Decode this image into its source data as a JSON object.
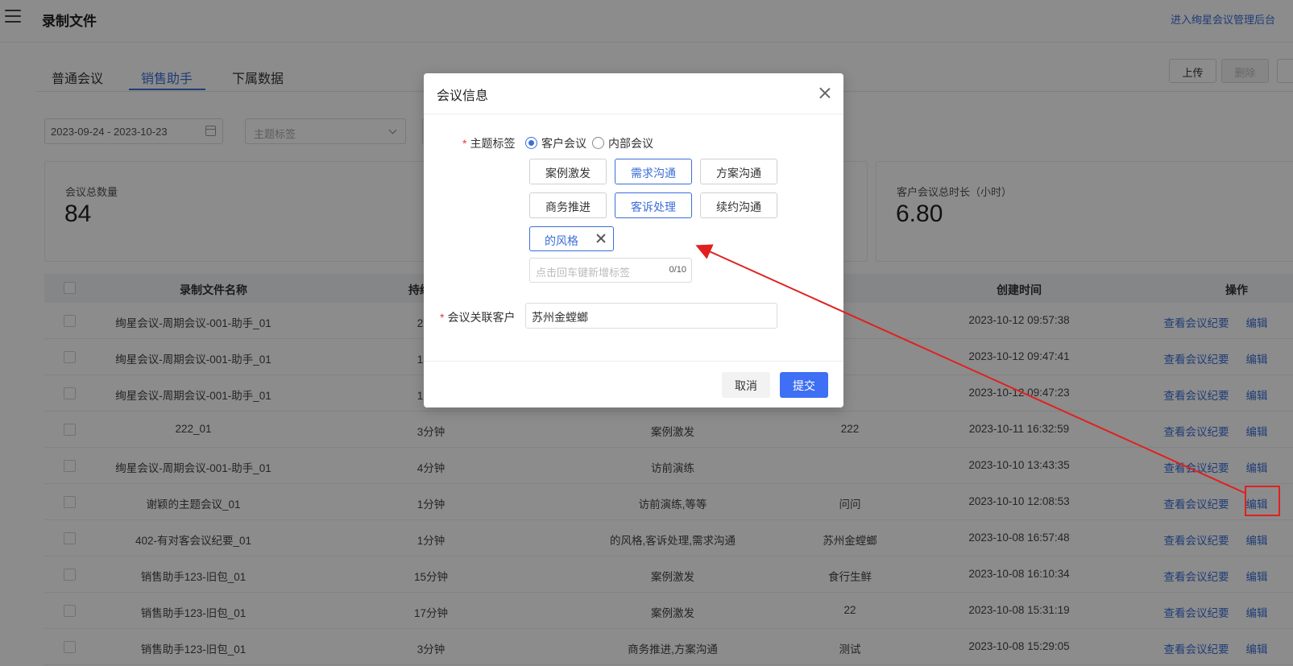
{
  "header": {
    "title": "录制文件",
    "admin_link": "进入绚星会议管理后台"
  },
  "tabs": [
    {
      "label": "普通会议"
    },
    {
      "label": "销售助手"
    },
    {
      "label": "下属数据"
    }
  ],
  "toolbar": {
    "upload_label": "上传",
    "delete_label": "删除"
  },
  "filters": {
    "date_range": "2023-09-24 - 2023-10-23",
    "topic_placeholder": "主题标签"
  },
  "stats": [
    {
      "label": "会议总数量",
      "value": "84"
    },
    {
      "label": "客户会议总时长（小时）",
      "value": "6.80"
    }
  ],
  "table": {
    "columns": [
      "录制文件名称",
      "持续时间",
      "",
      "",
      "创建时间",
      "操作"
    ],
    "rows": [
      {
        "name": "绚星会议-周期会议-001-助手_01",
        "duration": "2分钟",
        "tags": "",
        "customer": "",
        "created": "2023-10-12 09:57:38"
      },
      {
        "name": "绚星会议-周期会议-001-助手_01",
        "duration": "1分钟",
        "tags": "",
        "customer": "",
        "created": "2023-10-12 09:47:41"
      },
      {
        "name": "绚星会议-周期会议-001-助手_01",
        "duration": "1分钟",
        "tags": "",
        "customer": "",
        "created": "2023-10-12 09:47:23"
      },
      {
        "name": "222_01",
        "duration": "3分钟",
        "tags": "案例激发",
        "customer": "222",
        "created": "2023-10-11 16:32:59"
      },
      {
        "name": "绚星会议-周期会议-001-助手_01",
        "duration": "4分钟",
        "tags": "访前演练",
        "customer": "",
        "created": "2023-10-10 13:43:35"
      },
      {
        "name": "谢颖的主题会议_01",
        "duration": "1分钟",
        "tags": "访前演练,等等",
        "customer": "问问",
        "created": "2023-10-10 12:08:53"
      },
      {
        "name": "402-有对客会议纪要_01",
        "duration": "1分钟",
        "tags": "的风格,客诉处理,需求沟通",
        "customer": "苏州金螳螂",
        "created": "2023-10-08 16:57:48"
      },
      {
        "name": "销售助手123-旧包_01",
        "duration": "15分钟",
        "tags": "案例激发",
        "customer": "食行生鲜",
        "created": "2023-10-08 16:10:34"
      },
      {
        "name": "销售助手123-旧包_01",
        "duration": "17分钟",
        "tags": "案例激发",
        "customer": "22",
        "created": "2023-10-08 15:31:19"
      },
      {
        "name": "销售助手123-旧包_01",
        "duration": "3分钟",
        "tags": "商务推进,方案沟通",
        "customer": "测试",
        "created": "2023-10-08 15:29:05"
      }
    ],
    "action_view": "查看会议纪要",
    "action_edit": "编辑"
  },
  "modal": {
    "title": "会议信息",
    "topic_label": "主题标签",
    "radio_customer": "客户会议",
    "radio_internal": "内部会议",
    "tags": [
      "案例激发",
      "需求沟通",
      "方案沟通",
      "商务推进",
      "客诉处理",
      "续约沟通"
    ],
    "custom_tag": "的风格",
    "tag_input_placeholder": "点击回车键新增标签",
    "tag_input_count": "0/10",
    "customer_label": "会议关联客户",
    "customer_value": "苏州金螳螂",
    "cancel_label": "取消",
    "submit_label": "提交"
  },
  "colors": {
    "accent": "#3b6fd8",
    "submit": "#3e6ff4",
    "annotation": "#e02020"
  }
}
